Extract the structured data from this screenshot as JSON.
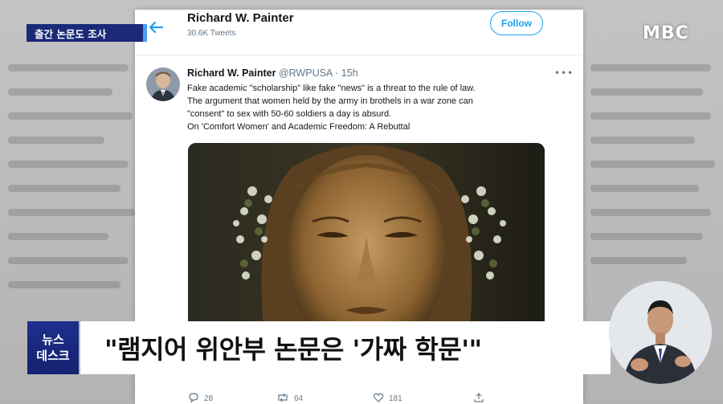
{
  "broadcaster": {
    "logo_text": "MBC"
  },
  "topic_tag": {
    "label": "출간 논문도 조사"
  },
  "profile_header": {
    "name": "Richard W. Painter",
    "tweets_count": "30.6K Tweets",
    "follow_label": "Follow",
    "back_icon": "back-arrow-icon"
  },
  "tweet": {
    "author_name": "Richard W. Painter",
    "handle_time": "@RWPUSA · 15h",
    "more_icon": "more-dots-icon",
    "lines": [
      "Fake academic \"scholarship\" like fake \"news\" is a threat to the rule of law.",
      "The argument that women held by the army in brothels in a war zone can",
      "\"consent\" to sex with 50-60 soldiers a day is absurd.",
      "On 'Comfort Women' and Academic Freedom: A Rebuttal"
    ],
    "media": {
      "description_icon": "statue-photo"
    },
    "actions": {
      "replies": "28",
      "retweets": "64",
      "likes": "181"
    }
  },
  "news_logo": {
    "line1": "뉴스",
    "line2": "데스크"
  },
  "headline": {
    "text": "\"램지어 위안부 논문은 '가짜 학문'\""
  },
  "colors": {
    "twitter_blue": "#1da1f2",
    "news_navy": "#1a2a78",
    "tag_accent": "#4a9df0"
  }
}
